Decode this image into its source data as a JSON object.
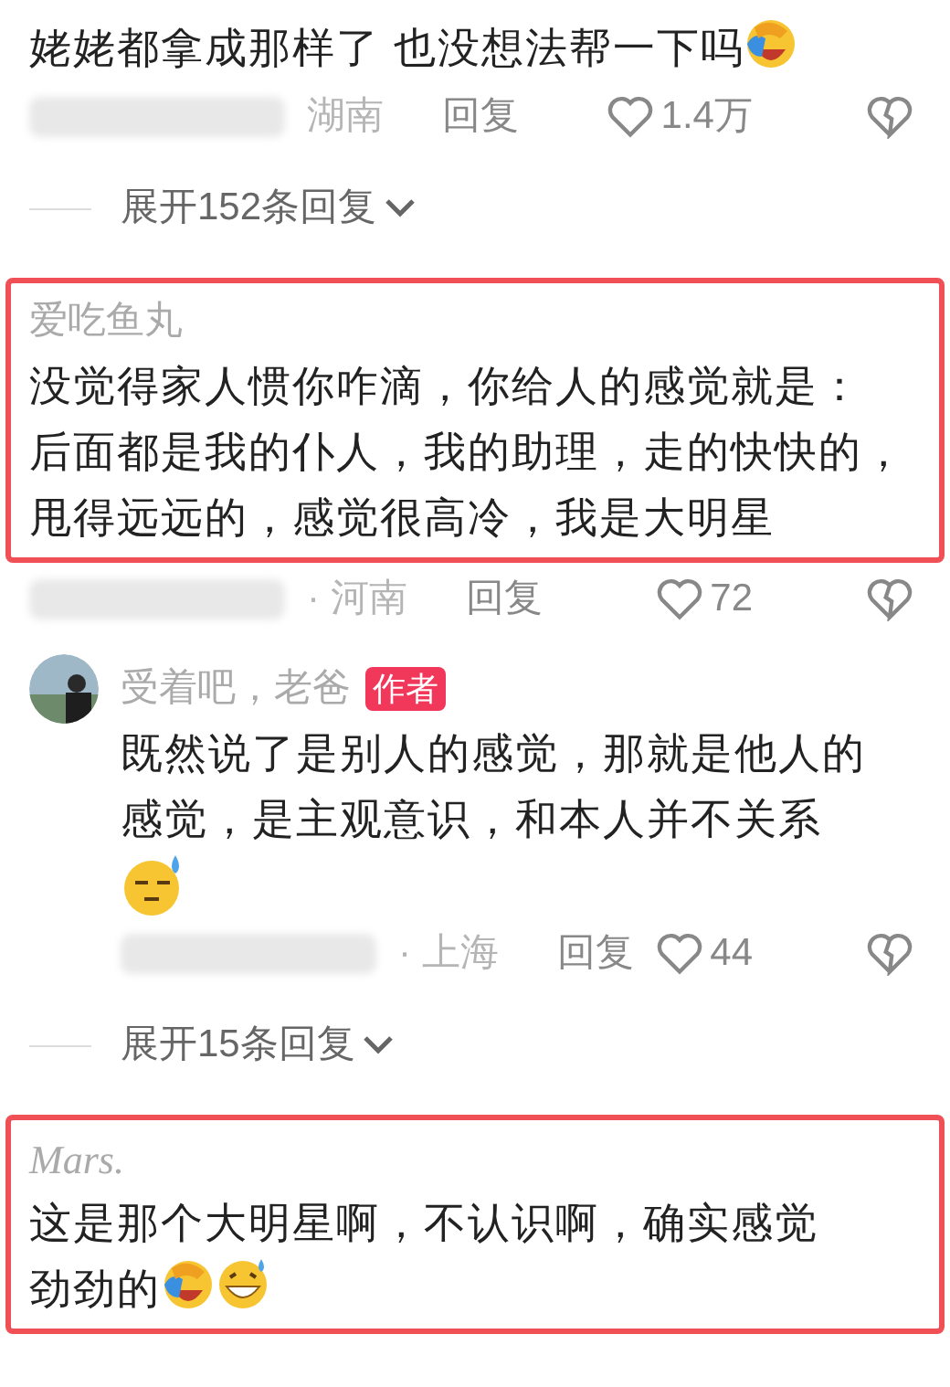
{
  "comments": [
    {
      "kind": "plain",
      "highlighted": false,
      "text_lines": [
        "姥姥都拿成那样了 也没想法帮一下吗"
      ],
      "emojis": [
        {
          "kind": "facepalm"
        }
      ],
      "meta": {
        "location": "湖南",
        "reply": "回复",
        "likes": "1.4万"
      },
      "expand": "展开152条回复"
    },
    {
      "kind": "plain",
      "highlighted": true,
      "author": "爱吃鱼丸",
      "text_lines": [
        "没觉得家人惯你咋滴，你给人的感觉就是：",
        "后面都是我的仆人，我的助理，走的快快的，",
        "甩得远远的，感觉很高冷，我是大明星"
      ],
      "meta": {
        "location": "· 河南",
        "reply": "回复",
        "likes": "72"
      }
    },
    {
      "kind": "avatar",
      "highlighted": false,
      "author": "受着吧，老爸",
      "badge": "作者",
      "text_lines": [
        "既然说了是别人的感觉，那就是他人的",
        "感觉，是主观意识，和本人并不关系"
      ],
      "emojis": [
        {
          "kind": "sweat"
        }
      ],
      "emoji_own_line": true,
      "meta": {
        "location": "· 上海",
        "reply": "回复",
        "likes": "44"
      },
      "expand": "展开15条回复"
    },
    {
      "kind": "serif-name",
      "highlighted": true,
      "author": "Mars.",
      "text_lines": [
        "这是那个大明星啊，不认识啊，确实感觉",
        "劲劲的"
      ],
      "emojis": [
        {
          "kind": "facepalm"
        },
        {
          "kind": "grin-sweat"
        }
      ]
    }
  ]
}
